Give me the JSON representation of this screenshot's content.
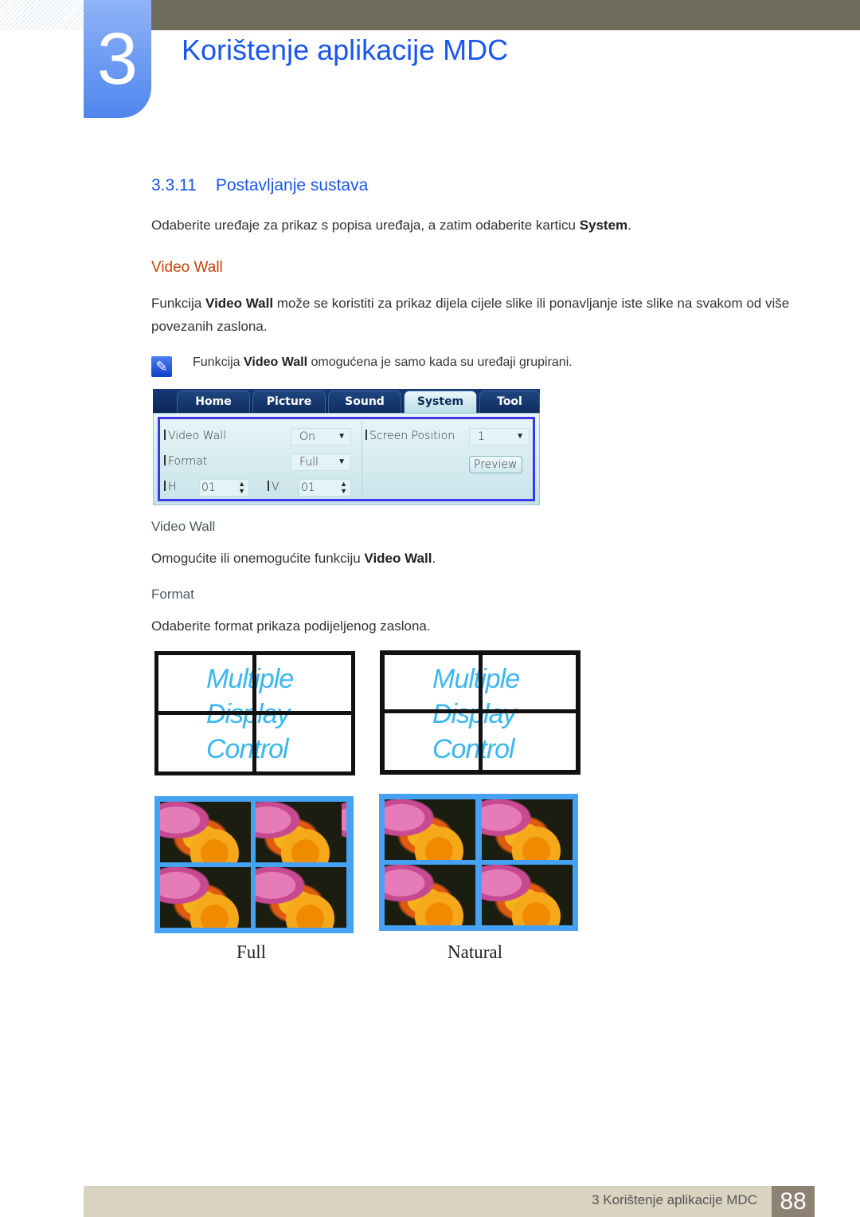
{
  "header": {
    "chapter_number": "3",
    "chapter_title": "Korištenje aplikacije MDC"
  },
  "section": {
    "number": "3.3.11",
    "title": "Postavljanje sustava"
  },
  "intro": {
    "text_before": "Odaberite uređaje za prikaz s popisa uređaja, a zatim odaberite karticu ",
    "bold": "System",
    "text_after": "."
  },
  "video_wall_heading": "Video Wall",
  "video_wall_desc": {
    "text_before": "Funkcija ",
    "bold": "Video Wall",
    "text_after": " može se koristiti za prikaz dijela cijele slike ili ponavljanje iste slike na svakom od više povezanih zaslona."
  },
  "note": {
    "icon": "note-pencil-icon",
    "text_before": "Funkcija ",
    "bold": "Video Wall",
    "text_after": " omogućena je samo kada su uređaji grupirani."
  },
  "app": {
    "tabs": [
      {
        "label": "Home",
        "active": false
      },
      {
        "label": "Picture",
        "active": false
      },
      {
        "label": "Sound",
        "active": false
      },
      {
        "label": "System",
        "active": true
      },
      {
        "label": "Tool",
        "active": false
      }
    ],
    "video_wall_label": "Video Wall",
    "video_wall_value": "On",
    "format_label": "Format",
    "format_value": "Full",
    "h_label": "H",
    "h_value": "01",
    "v_label": "V",
    "v_value": "01",
    "screen_position_label": "Screen Position",
    "screen_position_value": "1",
    "preview_button": "Preview",
    "dropdown_arrow": "▼",
    "spin_up": "▲",
    "spin_down": "▼"
  },
  "item_video_wall": {
    "heading": "Video Wall",
    "text_before": "Omogućite ili onemogućite funkciju ",
    "bold": "Video Wall",
    "text_after": "."
  },
  "item_format": {
    "heading": "Format",
    "text": "Odaberite format prikaza podijeljenog zaslona."
  },
  "illustrations": {
    "mdc_line1": "Multiple",
    "mdc_line2": "Display",
    "mdc_line3": "Control",
    "caption_full": "Full",
    "caption_natural": "Natural"
  },
  "footer": {
    "text": "3 Korištenje aplikacije MDC",
    "page": "88"
  }
}
